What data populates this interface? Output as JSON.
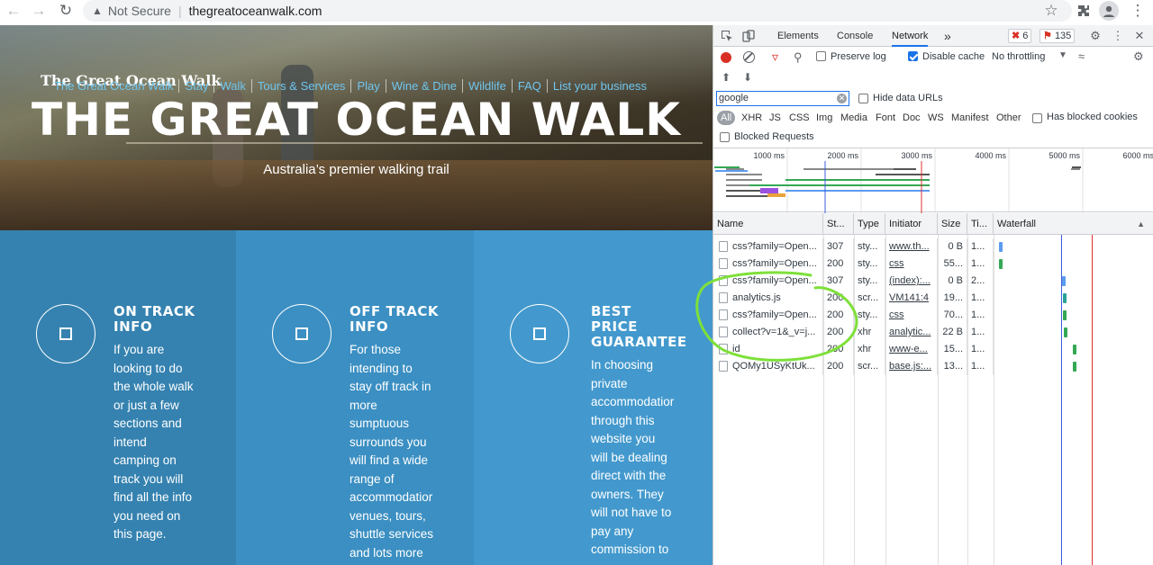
{
  "browser": {
    "security": "Not Secure",
    "url": "thegreatoceanwalk.com"
  },
  "site": {
    "logo": "The Great Ocean Walk",
    "nav": [
      "The Great Ocean Walk",
      "Stay",
      "Walk",
      "Tours & Services",
      "Play",
      "Wine & Dine",
      "Wildlife",
      "FAQ",
      "List your business"
    ],
    "hero_title": "THE GREAT OCEAN WALK",
    "hero_subtitle": "Australia’s premier walking trail",
    "panels": [
      {
        "title_lines": [
          "ON TRACK",
          "INFO"
        ],
        "body_lines": [
          "If you are",
          "looking to do",
          "the whole walk",
          "or just a few",
          "sections and",
          "intend",
          "camping on",
          "track you will",
          "find all the info",
          "you need on",
          "this page."
        ]
      },
      {
        "title_lines": [
          "OFF TRACK",
          "INFO"
        ],
        "body_lines": [
          "For those",
          "intending to",
          "stay off track in",
          "more",
          "sumptuous",
          "surrounds you",
          "will find a wide",
          "range of",
          "accommodatior",
          "venues, tours,",
          "shuttle services",
          "and lots more"
        ]
      },
      {
        "title_lines": [
          "BEST",
          "PRICE",
          "GUARANTEE"
        ],
        "body_lines": [
          "In choosing",
          "private",
          "accommodatior",
          "through this",
          "website you",
          "will be dealing",
          "direct with the",
          "owners. They",
          "will not have to",
          "pay any",
          "commission to"
        ]
      }
    ]
  },
  "devtools": {
    "tabs": [
      "Elements",
      "Console",
      "Network"
    ],
    "more_tabs": "»",
    "errors": "6",
    "warnings": "135",
    "preserve_log": "Preserve log",
    "disable_cache": "Disable cache",
    "throttling": "No throttling",
    "filter_value": "google",
    "hide_data_urls": "Hide data URLs",
    "types": [
      "All",
      "XHR",
      "JS",
      "CSS",
      "Img",
      "Media",
      "Font",
      "Doc",
      "WS",
      "Manifest",
      "Other"
    ],
    "has_blocked_cookies": "Has blocked cookies",
    "blocked_requests": "Blocked Requests",
    "timeline_ticks": [
      "1000 ms",
      "2000 ms",
      "3000 ms",
      "4000 ms",
      "5000 ms",
      "6000 ms"
    ],
    "columns": [
      "Name",
      "St...",
      "Type",
      "Initiator",
      "Size",
      "Ti...",
      "Waterfall"
    ],
    "rows": [
      {
        "name": "css?family=Open...",
        "status": "307",
        "type": "sty...",
        "initiator": "www.th...",
        "size": "0 B",
        "time": "1...",
        "wf_ms": 30,
        "wf_color": "#5b9bf0"
      },
      {
        "name": "css?family=Open...",
        "status": "200",
        "type": "sty...",
        "initiator": "css",
        "size": "55...",
        "time": "1...",
        "wf_ms": 50,
        "wf_color": "#34a853"
      },
      {
        "name": "css?family=Open...",
        "status": "307",
        "type": "sty...",
        "initiator": "(index):...",
        "size": "0 B",
        "time": "2...",
        "wf_ms": 2760,
        "wf_color": "#5b9bf0"
      },
      {
        "name": "analytics.js",
        "status": "200",
        "type": "scr...",
        "initiator": "VM141:4",
        "size": "19...",
        "time": "1...",
        "wf_ms": 2790,
        "wf_color": "#2aa198"
      },
      {
        "name": "css?family=Open...",
        "status": "200",
        "type": "sty...",
        "initiator": "css",
        "size": "70...",
        "time": "1...",
        "wf_ms": 2790,
        "wf_color": "#34a853"
      },
      {
        "name": "collect?v=1&_v=j...",
        "status": "200",
        "type": "xhr",
        "initiator": "analytic...",
        "size": "22 B",
        "time": "1...",
        "wf_ms": 2840,
        "wf_color": "#34a853"
      },
      {
        "name": "id",
        "status": "200",
        "type": "xhr",
        "initiator": "www-e...",
        "size": "15...",
        "time": "1...",
        "wf_ms": 3200,
        "wf_color": "#34a853"
      },
      {
        "name": "QOMy1USyKtUk...",
        "status": "200",
        "type": "scr...",
        "initiator": "base.js:...",
        "size": "13...",
        "time": "1...",
        "wf_ms": 3200,
        "wf_color": "#34a853"
      }
    ],
    "colors": {
      "accent": "#1a73e8",
      "dom_content_loaded": "#3c5cdb",
      "load": "#e03030",
      "annotation": "#7ee03a"
    }
  }
}
